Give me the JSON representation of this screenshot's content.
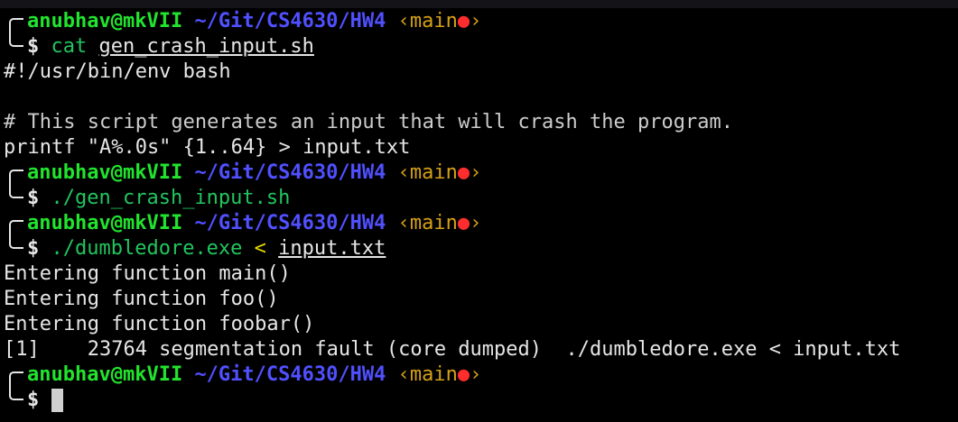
{
  "colors": {
    "background": "#000000",
    "text": "#e6e6e6",
    "user": "#22e32e",
    "path": "#5050ff",
    "branch": "#d4a017",
    "dirty": "#ff2d2d",
    "command": "#22c55e",
    "redirect": "#e8d800",
    "comment": "#cccccc",
    "cursor": "#d0d0d0"
  },
  "prompts": [
    {
      "user": "anubhav@mkVII",
      "path": "~/Git/CS4630/HW4",
      "branch_open": "‹",
      "branch": "main",
      "dirty": "●",
      "branch_close": "›",
      "symbol": "$"
    },
    {
      "user": "anubhav@mkVII",
      "path": "~/Git/CS4630/HW4",
      "branch_open": "‹",
      "branch": "main",
      "dirty": "●",
      "branch_close": "›",
      "symbol": "$"
    },
    {
      "user": "anubhav@mkVII",
      "path": "~/Git/CS4630/HW4",
      "branch_open": "‹",
      "branch": "main",
      "dirty": "●",
      "branch_close": "›",
      "symbol": "$"
    },
    {
      "user": "anubhav@mkVII",
      "path": "~/Git/CS4630/HW4",
      "branch_open": "‹",
      "branch": "main",
      "dirty": "●",
      "branch_close": "›",
      "symbol": "$"
    }
  ],
  "commands": [
    {
      "cmd": "cat",
      "arg": "gen_crash_input.sh"
    },
    {
      "cmd": "./gen_crash_input.sh"
    },
    {
      "cmd": "./dumbledore.exe",
      "redirect": "<",
      "arg": "input.txt"
    }
  ],
  "output": {
    "script_shebang": "#!/usr/bin/env bash",
    "script_blank": "",
    "script_comment": "# This script generates an input that will crash the program.",
    "script_printf": "printf \"A%.0s\" {1..64} > input.txt",
    "run_lines": [
      "Entering function main()",
      "Entering function foo()",
      "Entering function foobar()"
    ],
    "segfault": "[1]    23764 segmentation fault (core dumped)  ./dumbledore.exe < input.txt"
  }
}
